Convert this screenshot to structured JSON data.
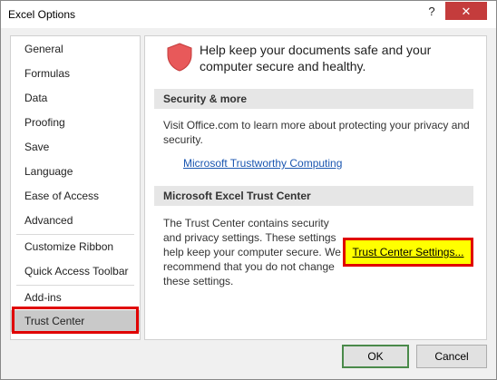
{
  "window": {
    "title": "Excel Options",
    "help_label": "?",
    "close_label": "✕"
  },
  "nav": {
    "items": [
      {
        "label": "General"
      },
      {
        "label": "Formulas"
      },
      {
        "label": "Data"
      },
      {
        "label": "Proofing"
      },
      {
        "label": "Save"
      },
      {
        "label": "Language"
      },
      {
        "label": "Ease of Access"
      },
      {
        "label": "Advanced"
      },
      {
        "label": "Customize Ribbon"
      },
      {
        "label": "Quick Access Toolbar"
      },
      {
        "label": "Add-ins"
      },
      {
        "label": "Trust Center"
      }
    ],
    "selected": "Trust Center"
  },
  "content": {
    "intro_icon": "shield-icon",
    "intro_text": "Help keep your documents safe and your computer secure and healthy.",
    "security": {
      "heading": "Security & more",
      "text": "Visit Office.com to learn more about protecting your privacy and security.",
      "link": "Microsoft Trustworthy Computing"
    },
    "trust_center": {
      "heading": "Microsoft Excel Trust Center",
      "text": "The Trust Center contains security and privacy settings. These settings help keep your computer secure. We recommend that you do not change these settings.",
      "button_label": "Trust Center Settings..."
    }
  },
  "footer": {
    "ok_label": "OK",
    "cancel_label": "Cancel"
  },
  "colors": {
    "highlight_outline": "#e00000",
    "highlight_fill": "#ffff00",
    "link": "#1a56b0",
    "shield": "#e8595a"
  }
}
